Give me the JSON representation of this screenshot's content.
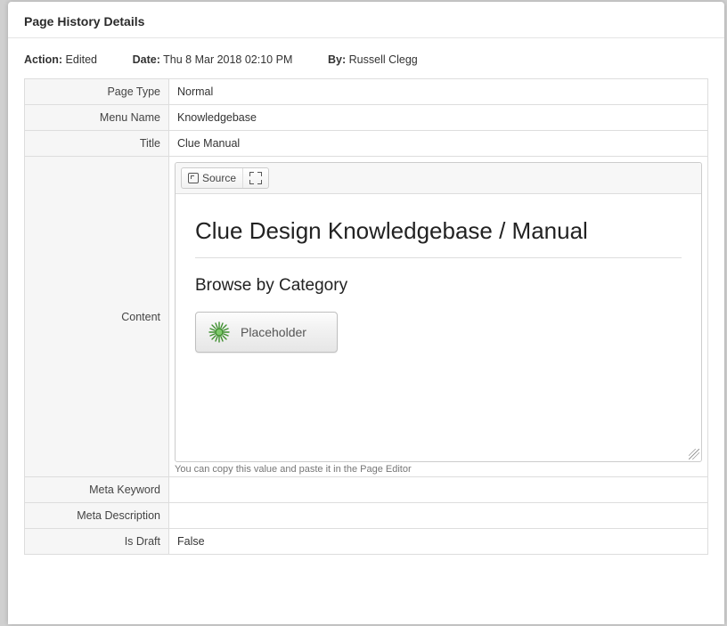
{
  "dialog": {
    "title": "Page History Details"
  },
  "meta": {
    "action_label": "Action:",
    "action_value": "Edited",
    "date_label": "Date:",
    "date_value": "Thu 8 Mar 2018 02:10 PM",
    "by_label": "By:",
    "by_value": "Russell Clegg"
  },
  "rows": {
    "page_type": {
      "label": "Page Type",
      "value": "Normal"
    },
    "menu_name": {
      "label": "Menu Name",
      "value": "Knowledgebase"
    },
    "title": {
      "label": "Title",
      "value": "Clue Manual"
    },
    "content": {
      "label": "Content"
    },
    "meta_keyword": {
      "label": "Meta Keyword",
      "value": ""
    },
    "meta_description": {
      "label": "Meta Description",
      "value": ""
    },
    "is_draft": {
      "label": "Is Draft",
      "value": "False"
    }
  },
  "editor": {
    "source_label": "Source",
    "doc_h1": "Clue Design Knowledgebase / Manual",
    "doc_h2": "Browse by Category",
    "placeholder_label": "Placeholder",
    "hint": "You can copy this value and paste it in the Page Editor"
  }
}
